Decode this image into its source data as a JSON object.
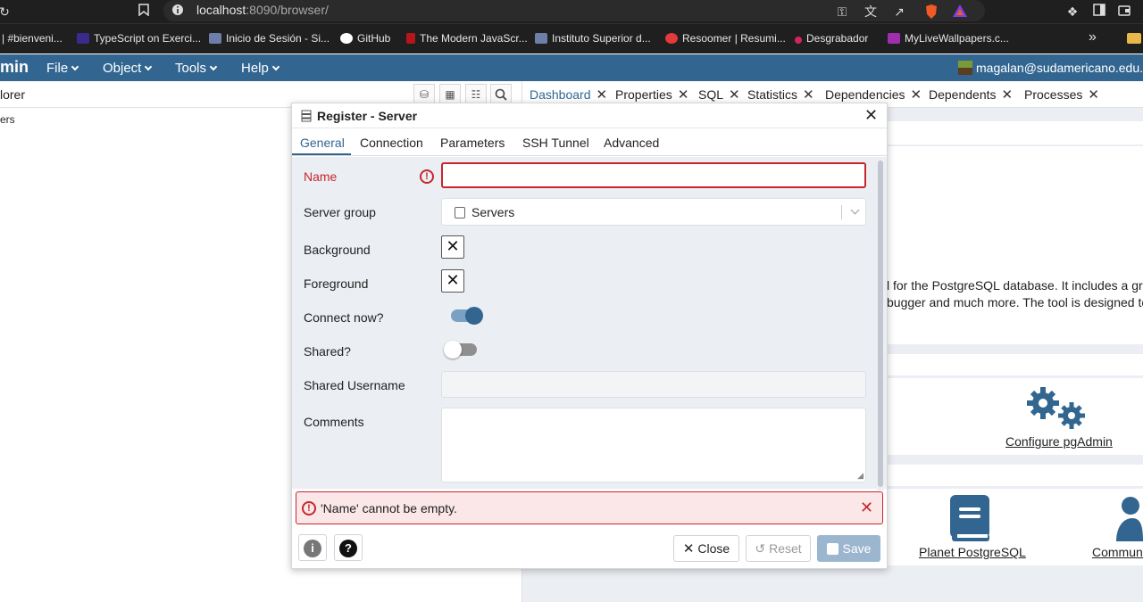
{
  "browser": {
    "url_host": "localhost",
    "url_rest": ":8090/browser/",
    "bookmarks": [
      {
        "label": "| #bienveni...",
        "color": "#4a154b"
      },
      {
        "label": "TypeScript on Exerci...",
        "color": "#3b2a8c"
      },
      {
        "label": "Inicio de Sesión - Si...",
        "color": "#6d7fa8"
      },
      {
        "label": "GitHub",
        "color": "#ffffff"
      },
      {
        "label": "The Modern JavaScr...",
        "color": "#b4161b"
      },
      {
        "label": "Instituto Superior d...",
        "color": "#6d7fa8"
      },
      {
        "label": "Resoomer | Resumi...",
        "color": "#e33b3b"
      },
      {
        "label": "Desgrabador",
        "color": "#d4245a"
      },
      {
        "label": "MyLiveWallpapers.c...",
        "color": "#a02fb0"
      }
    ],
    "overflow": "»"
  },
  "app": {
    "logo": "min",
    "menus": [
      "File",
      "Object",
      "Tools",
      "Help"
    ],
    "user": "magalan@sudamericano.edu."
  },
  "explorer": {
    "title": "lorer",
    "tree_item": "ers"
  },
  "right_tabs": [
    {
      "label": "Dashboard",
      "active": true
    },
    {
      "label": "Properties"
    },
    {
      "label": "SQL"
    },
    {
      "label": "Statistics"
    },
    {
      "label": "Dependencies"
    },
    {
      "label": "Dependents"
    },
    {
      "label": "Processes"
    }
  ],
  "dashboard": {
    "blurb_line1": "l for the PostgreSQL database. It includes a grap",
    "blurb_line2": "bugger and much more. The tool is designed to",
    "configure_link": "Configure pgAdmin",
    "planet_link": "Planet PostgreSQL",
    "community_link": "Communi"
  },
  "dialog": {
    "title": "Register - Server",
    "tabs": [
      "General",
      "Connection",
      "Parameters",
      "SSH Tunnel",
      "Advanced"
    ],
    "fields": {
      "name_label": "Name",
      "name_value": "",
      "server_group_label": "Server group",
      "server_group_value": "Servers",
      "background_label": "Background",
      "foreground_label": "Foreground",
      "connect_now_label": "Connect now?",
      "connect_now": true,
      "shared_label": "Shared?",
      "shared": false,
      "shared_username_label": "Shared Username",
      "shared_username_value": "",
      "comments_label": "Comments"
    },
    "error_message": "'Name' cannot be empty.",
    "buttons": {
      "close": "Close",
      "reset": "Reset",
      "save": "Save"
    }
  },
  "colors": {
    "brand": "#326690",
    "error": "#c7262d",
    "save_disabled": "#9cb6cf"
  }
}
